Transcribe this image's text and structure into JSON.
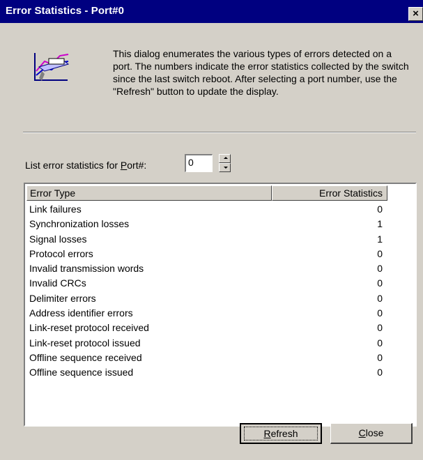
{
  "window": {
    "title": "Error Statistics - Port#0",
    "close_glyph": "×"
  },
  "intro": {
    "icon": "statistics-chart-icon",
    "text": "This dialog enumerates the various types of errors detected on a port. The numbers indicate the error statistics collected by the switch since the last switch reboot. After selecting a port number, use the \"Refresh\" button to update the display."
  },
  "port": {
    "label_prefix": "List error statistics for ",
    "label_underlined": "P",
    "label_suffix": "ort#:",
    "value": "0"
  },
  "table": {
    "columns": [
      "Error Type",
      "Error Statistics"
    ],
    "rows": [
      [
        "Link failures",
        "0"
      ],
      [
        "Synchronization losses",
        "1"
      ],
      [
        "Signal losses",
        "1"
      ],
      [
        "Protocol errors",
        "0"
      ],
      [
        "Invalid transmission words",
        "0"
      ],
      [
        "Invalid CRCs",
        "0"
      ],
      [
        "Delimiter errors",
        "0"
      ],
      [
        "Address identifier errors",
        "0"
      ],
      [
        "Link-reset protocol received",
        "0"
      ],
      [
        "Link-reset protocol issued",
        "0"
      ],
      [
        "Offline sequence received",
        "0"
      ],
      [
        "Offline sequence issued",
        "0"
      ]
    ]
  },
  "buttons": {
    "refresh_underlined": "R",
    "refresh_rest": "efresh",
    "close_underlined": "C",
    "close_rest": "lose"
  },
  "colors": {
    "titlebar": "#000080",
    "face": "#d4d0c8"
  }
}
